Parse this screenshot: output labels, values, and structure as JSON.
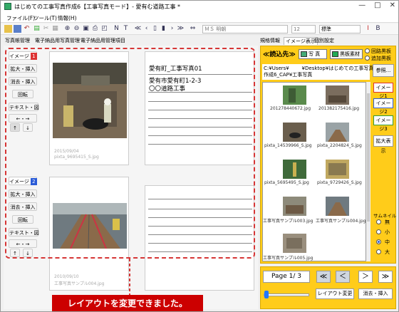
{
  "window": {
    "title": "はじめての工事写真作成6【工事写真モード】- 愛有む道路工事 *",
    "minimize": "—",
    "maximize": "□",
    "close": "✕"
  },
  "menu": [
    "ファイル(F)",
    "ツール(T)",
    "情報(H)"
  ],
  "toolbar": {
    "font_name": "ＭＳ 明朝",
    "font_size": "12",
    "style": "標準"
  },
  "left_tabs": [
    "写真帳管理",
    "電子納品用写真管理",
    "電子納品用管理項目"
  ],
  "side": {
    "image1_label": "イメージ",
    "image1_num": "1",
    "image2_label": "イメージ",
    "image2_num": "2",
    "enlarge": "拡大・挿入",
    "erase": "消去・挿入",
    "rotate": "回転",
    "text": "テキスト・図",
    "arrows_lr": "←・→",
    "up": "↑",
    "down": "↓"
  },
  "card1": {
    "date": "2015/09/04",
    "file": "pixta_9695415_S.jpg",
    "caption1": "愛有町_工事写真01",
    "caption2": "愛有市愛有町1-2-3",
    "caption3": "〇〇道路工事"
  },
  "card2": {
    "date": "2010/09/10",
    "file": "工事写真サンプル004.jpg"
  },
  "notice": "レイアウトを変更できました。",
  "right_tabs": [
    "規格情報",
    "イメージ表示",
    "個別設定"
  ],
  "read": {
    "label": "≪読込先≫",
    "photo": "写 真",
    "board": "黒板素材",
    "opt1": "回路黒板",
    "opt2": "追加黒板"
  },
  "path": "C:¥Users¥        ¥Desktop¥はじめての工事写真\n作成6_CAP¥工事写真",
  "ref": "参照...",
  "files": [
    "201278440672.jpg",
    "201382175416.jpg",
    "pixta_14539966_S.jpg",
    "pixta_2204824_S.jpg",
    "pixta_5695495_S.jpg",
    "pixta_9729426_S.jpg",
    "工事写真サンプル003.jpg",
    "工事写真サンプル004.jpg",
    "工事写真サンプル005.jpg"
  ],
  "image_side": {
    "img1": "イメージ1",
    "img2": "イメージ2",
    "img3": "イメージ3",
    "enlarge": "拡大表示"
  },
  "thumbnail": {
    "label": "サムネイル",
    "sizes": [
      "無",
      "小",
      "中",
      "大"
    ],
    "selected": "中"
  },
  "page": {
    "text": "Page 1/ 3",
    "first": "≪",
    "prev": "＜",
    "next": "＞",
    "last": "≫"
  },
  "bottom": {
    "layout": "レイアウト変更",
    "erase": "消去・挿入"
  },
  "colors": {
    "accent": "#ffcc1a",
    "red": "#cc0000",
    "blue": "#2a5bd7",
    "green": "#2f9a3a"
  }
}
